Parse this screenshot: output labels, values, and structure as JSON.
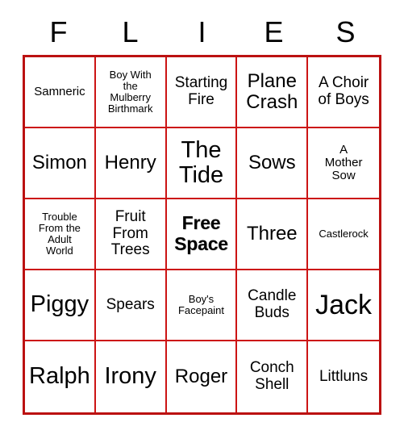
{
  "card": {
    "header_letters": [
      "F",
      "L",
      "I",
      "E",
      "S"
    ],
    "rows": [
      [
        {
          "text": "Samneric",
          "size": "sz-s",
          "free": false
        },
        {
          "text": "Boy With\nthe\nMulberry\nBirthmark",
          "size": "sz-xs",
          "free": false
        },
        {
          "text": "Starting\nFire",
          "size": "sz-m",
          "free": false
        },
        {
          "text": "Plane\nCrash",
          "size": "sz-l",
          "free": false
        },
        {
          "text": "A Choir\nof Boys",
          "size": "sz-m",
          "free": false
        }
      ],
      [
        {
          "text": "Simon",
          "size": "sz-l",
          "free": false
        },
        {
          "text": "Henry",
          "size": "sz-l",
          "free": false
        },
        {
          "text": "The\nTide",
          "size": "sz-xl",
          "free": false
        },
        {
          "text": "Sows",
          "size": "sz-l",
          "free": false
        },
        {
          "text": "A\nMother\nSow",
          "size": "sz-s",
          "free": false
        }
      ],
      [
        {
          "text": "Trouble\nFrom the\nAdult\nWorld",
          "size": "sz-xs",
          "free": false
        },
        {
          "text": "Fruit\nFrom\nTrees",
          "size": "sz-m",
          "free": false
        },
        {
          "text": "Free\nSpace",
          "size": "sz-l",
          "free": true
        },
        {
          "text": "Three",
          "size": "sz-l",
          "free": false
        },
        {
          "text": "Castlerock",
          "size": "sz-xs",
          "free": false
        }
      ],
      [
        {
          "text": "Piggy",
          "size": "sz-xl",
          "free": false
        },
        {
          "text": "Spears",
          "size": "sz-m",
          "free": false
        },
        {
          "text": "Boy's\nFacepaint",
          "size": "sz-xs",
          "free": false
        },
        {
          "text": "Candle\nBuds",
          "size": "sz-m",
          "free": false
        },
        {
          "text": "Jack",
          "size": "sz-xxl",
          "free": false
        }
      ],
      [
        {
          "text": "Ralph",
          "size": "sz-xl",
          "free": false
        },
        {
          "text": "Irony",
          "size": "sz-xl",
          "free": false
        },
        {
          "text": "Roger",
          "size": "sz-l",
          "free": false
        },
        {
          "text": "Conch\nShell",
          "size": "sz-m",
          "free": false
        },
        {
          "text": "Littluns",
          "size": "sz-m",
          "free": false
        }
      ]
    ]
  },
  "colors": {
    "grid_border": "#bb1111",
    "grid_line": "#cc1414",
    "text": "#000000",
    "background": "#ffffff"
  }
}
